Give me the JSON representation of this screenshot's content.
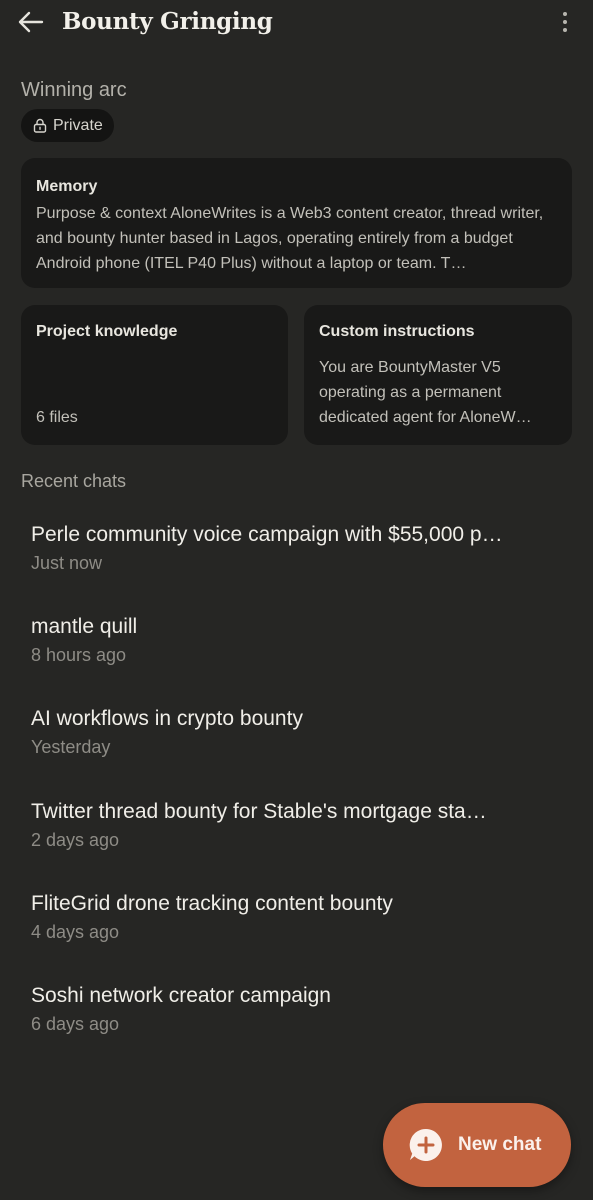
{
  "header": {
    "title": "Bounty Gringing",
    "back_icon": "arrow-left-icon",
    "menu_icon": "more-vertical-icon"
  },
  "project": {
    "subtitle": "Winning arc",
    "visibility": "Private",
    "visibility_icon": "lock-icon"
  },
  "memory": {
    "title": "Memory",
    "text": "Purpose & context AloneWrites is a Web3 content creator, thread writer, and bounty hunter based in Lagos, operating entirely from a budget Android phone (ITEL P40 Plus) without a laptop or team. T…"
  },
  "knowledge": {
    "title": "Project knowledge",
    "files": "6 files"
  },
  "instructions": {
    "title": "Custom instructions",
    "text": "You are BountyMaster V5 operating as a permanent dedicated agent for AloneW…"
  },
  "recent": {
    "label": "Recent chats",
    "chats": [
      {
        "title": "Perle community voice campaign with $55,000 p…",
        "time": "Just now"
      },
      {
        "title": "mantle quill",
        "time": "8 hours ago"
      },
      {
        "title": "AI workflows in crypto bounty",
        "time": "Yesterday"
      },
      {
        "title": "Twitter thread bounty for Stable's mortgage sta…",
        "time": "2 days ago"
      },
      {
        "title": "FliteGrid drone tracking content bounty",
        "time": "4 days ago"
      },
      {
        "title": "Soshi network creator campaign",
        "time": "6 days ago"
      }
    ]
  },
  "fab": {
    "label": "New chat",
    "icon": "plus-bubble-icon",
    "color": "#c2633f"
  }
}
